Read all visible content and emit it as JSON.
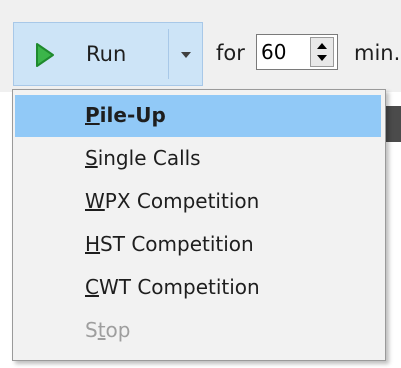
{
  "toolbar": {
    "run_label": "Run",
    "run_icon": "play-icon",
    "dropdown_icon": "chevron-down-icon",
    "for_label": "for",
    "duration_value": "60",
    "unit_label": "min."
  },
  "menu": {
    "items": [
      {
        "label": "Pile-Up",
        "mnemonic": "P"
      },
      {
        "label": "Single Calls",
        "mnemonic": "S"
      },
      {
        "label": "WPX Competition",
        "mnemonic": "W"
      },
      {
        "label": "HST Competition",
        "mnemonic": "H"
      },
      {
        "label": "CWT Competition",
        "mnemonic": "C"
      },
      {
        "label": "Stop",
        "mnemonic": "t"
      }
    ],
    "highlighted": "Pile-Up",
    "disabled": "Stop"
  },
  "colors": {
    "run_button_bg": "#cde4f7",
    "play_icon": "#3bb54a",
    "menu_highlight": "#91c9f7",
    "disabled_text": "#9e9e9e"
  }
}
